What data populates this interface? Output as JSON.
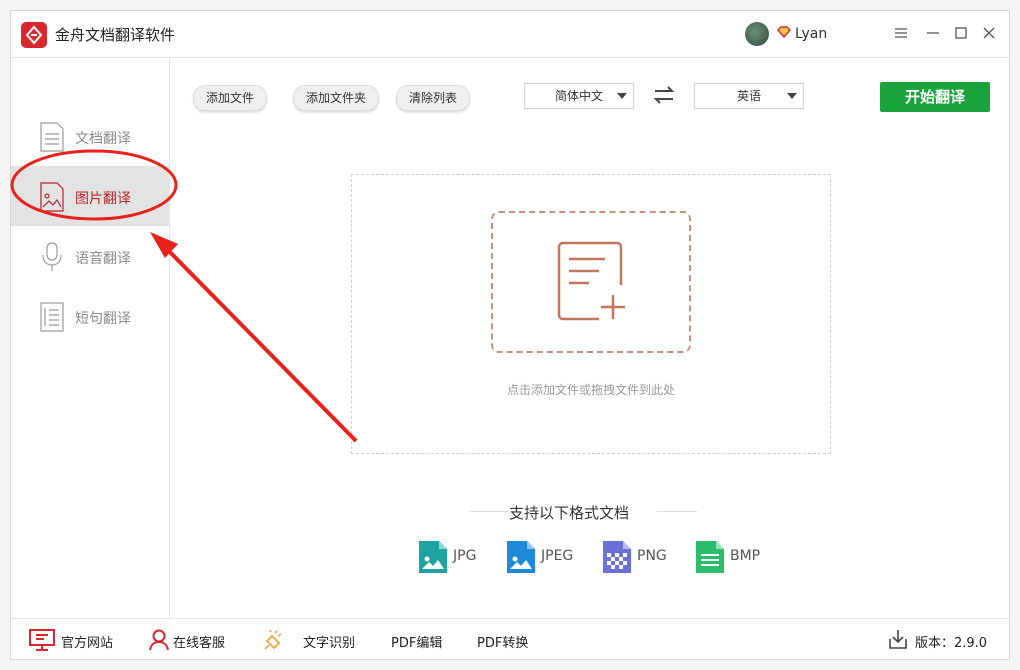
{
  "app": {
    "title": "金舟文档翻译软件"
  },
  "user": {
    "name": "Lyan"
  },
  "sidebar": {
    "items": [
      {
        "label": "文档翻译",
        "icon": "document-icon",
        "active": false
      },
      {
        "label": "图片翻译",
        "icon": "image-icon",
        "active": true
      },
      {
        "label": "语音翻译",
        "icon": "microphone-icon",
        "active": false
      },
      {
        "label": "短句翻译",
        "icon": "text-lines-icon",
        "active": false
      }
    ]
  },
  "toolbar": {
    "add_file": "添加文件",
    "add_folder": "添加文件夹",
    "clear_list": "清除列表",
    "source_lang": "简体中文",
    "target_lang": "英语",
    "start": "开始翻译"
  },
  "dropzone": {
    "hint": "点击添加文件或拖拽文件到此处"
  },
  "formats": {
    "title": "支持以下格式文档",
    "items": [
      {
        "label": "JPG",
        "icon": "jpg-file-icon"
      },
      {
        "label": "JPEG",
        "icon": "jpeg-file-icon"
      },
      {
        "label": "PNG",
        "icon": "png-file-icon"
      },
      {
        "label": "BMP",
        "icon": "bmp-file-icon"
      }
    ]
  },
  "bottombar": {
    "website": "官方网站",
    "support": "在线客服",
    "ocr": "文字识别",
    "pdf_edit": "PDF编辑",
    "pdf_convert": "PDF转换",
    "version": "版本：2.9.0"
  },
  "colors": {
    "brand_red": "#d9272e",
    "start_green": "#1aa33a",
    "annotation_red": "#e8221b",
    "active_label": "#b0262b"
  }
}
